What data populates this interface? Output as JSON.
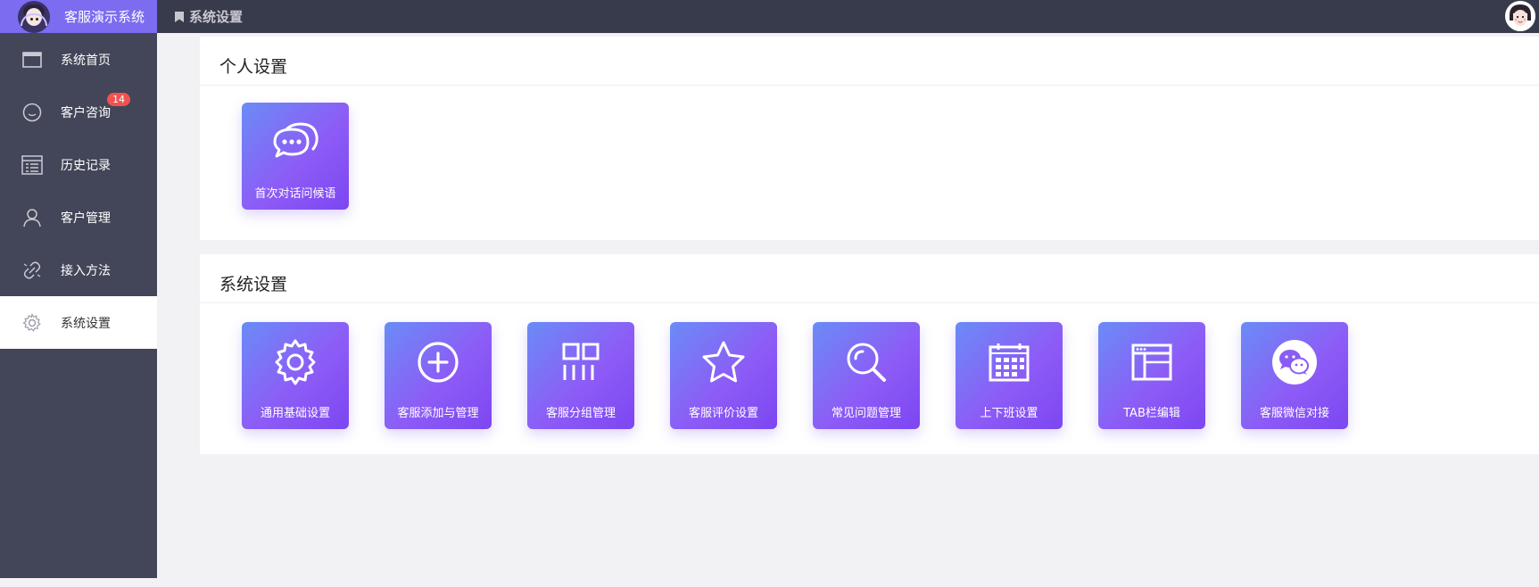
{
  "app": {
    "title": "客服演示系统"
  },
  "header": {
    "page_title": "系统设置"
  },
  "sidebar": {
    "items": [
      {
        "label": "系统首页",
        "icon": "window-icon"
      },
      {
        "label": "客户咨询",
        "icon": "smile-icon",
        "badge": "14"
      },
      {
        "label": "历史记录",
        "icon": "list-icon"
      },
      {
        "label": "客户管理",
        "icon": "user-icon"
      },
      {
        "label": "接入方法",
        "icon": "link-icon"
      },
      {
        "label": "系统设置",
        "icon": "gear-icon",
        "active": true
      }
    ]
  },
  "personal": {
    "title": "个人设置",
    "tiles": [
      {
        "label": "首次对话问候语",
        "icon": "chat-bubbles-icon"
      }
    ]
  },
  "system": {
    "title": "系统设置",
    "tiles": [
      {
        "label": "通用基础设置",
        "icon": "gear-icon"
      },
      {
        "label": "客服添加与管理",
        "icon": "plus-circle-icon"
      },
      {
        "label": "客服分组管理",
        "icon": "grid-icon"
      },
      {
        "label": "客服评价设置",
        "icon": "star-icon"
      },
      {
        "label": "常见问题管理",
        "icon": "search-icon"
      },
      {
        "label": "上下班设置",
        "icon": "calendar-icon"
      },
      {
        "label": "TAB栏编辑",
        "icon": "browser-window-icon"
      },
      {
        "label": "客服微信对接",
        "icon": "wechat-icon"
      }
    ]
  },
  "colors": {
    "brand": "#7b6cf0",
    "sidebar": "#434658",
    "topbar": "#383b4b",
    "tile_start": "#6a8cf6",
    "tile_end": "#7d46f2",
    "badge": "#ef5350"
  }
}
